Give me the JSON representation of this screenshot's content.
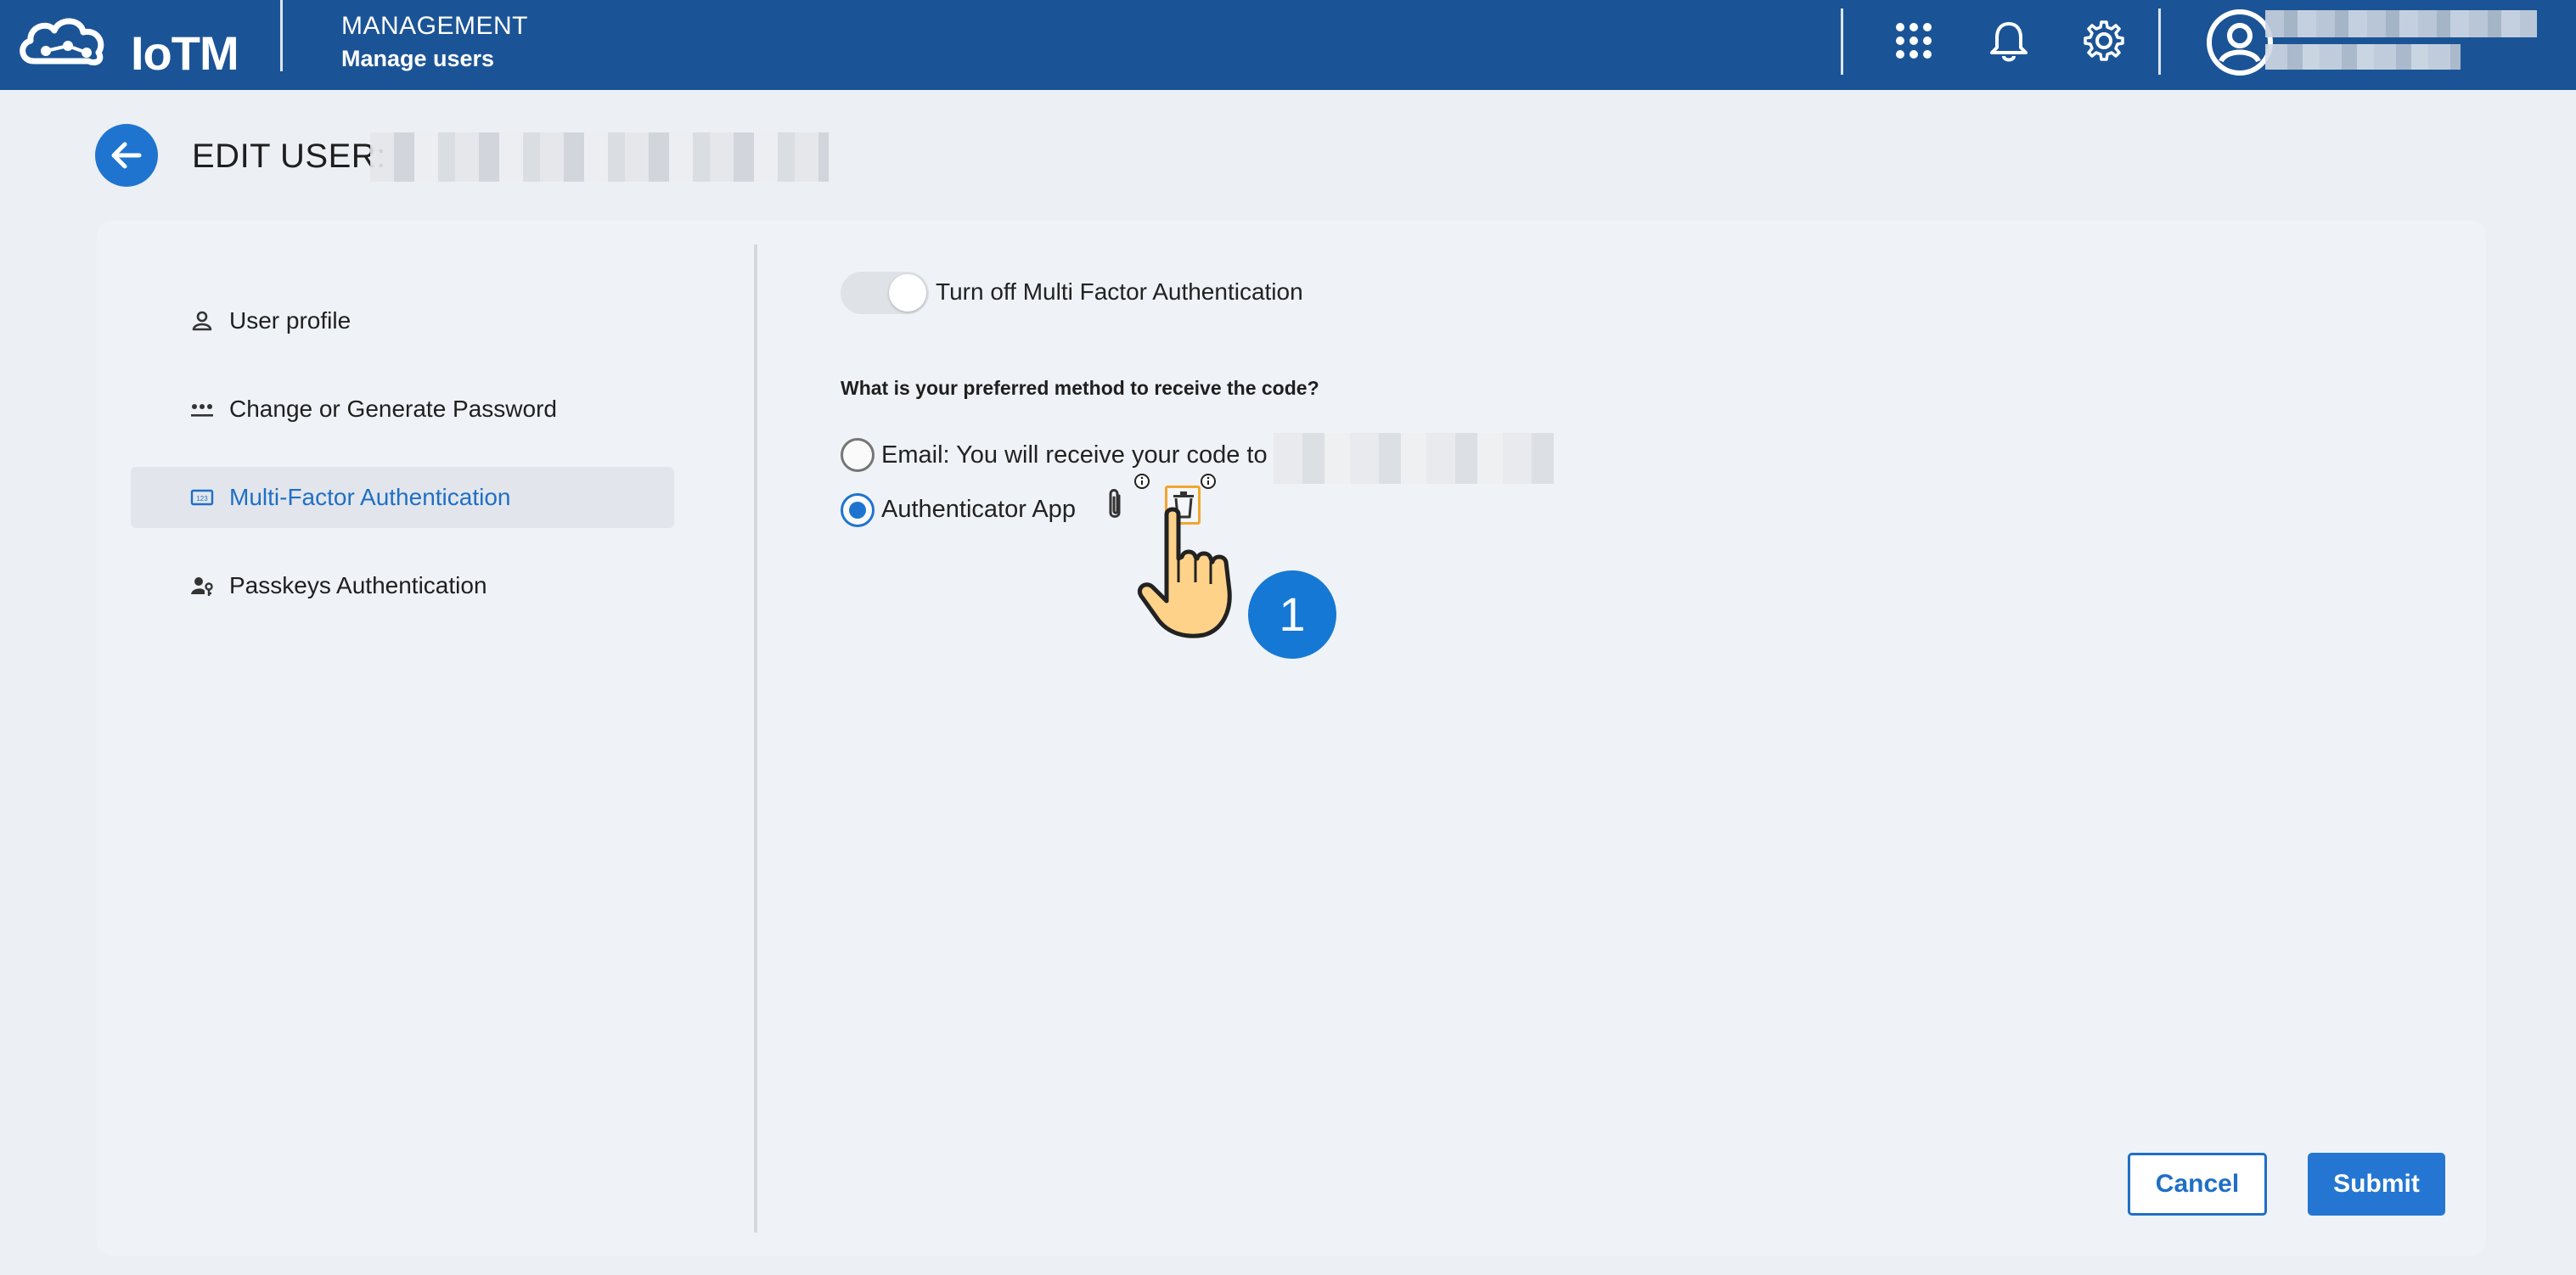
{
  "header": {
    "app_name": "IoTM",
    "section_title": "MANAGEMENT",
    "section_subtitle": "Manage users",
    "icons": [
      "apps-grid-icon",
      "bell-icon",
      "gear-icon",
      "user-avatar-icon"
    ]
  },
  "page": {
    "title": "EDIT USER:"
  },
  "sidebar": {
    "items": [
      {
        "label": "User profile",
        "icon": "person-icon",
        "active": false
      },
      {
        "label": "Change or Generate Password",
        "icon": "password-dots-icon",
        "active": false
      },
      {
        "label": "Multi-Factor Authentication",
        "icon": "number-pad-icon",
        "active": true
      },
      {
        "label": "Passkeys Authentication",
        "icon": "user-key-icon",
        "active": false
      }
    ]
  },
  "mfa": {
    "toggle_label": "Turn off Multi Factor Authentication",
    "toggle_on": true,
    "question": "What is your preferred method to receive the code?",
    "options": [
      {
        "label": "Email: You will receive your code to",
        "selected": false
      },
      {
        "label": "Authenticator App",
        "selected": true
      }
    ]
  },
  "annotation": {
    "step_number": "1"
  },
  "actions": {
    "cancel_label": "Cancel",
    "submit_label": "Submit"
  },
  "colors": {
    "header_bg": "#1b5496",
    "accent": "#1f74cf",
    "highlight": "#f2a530"
  }
}
